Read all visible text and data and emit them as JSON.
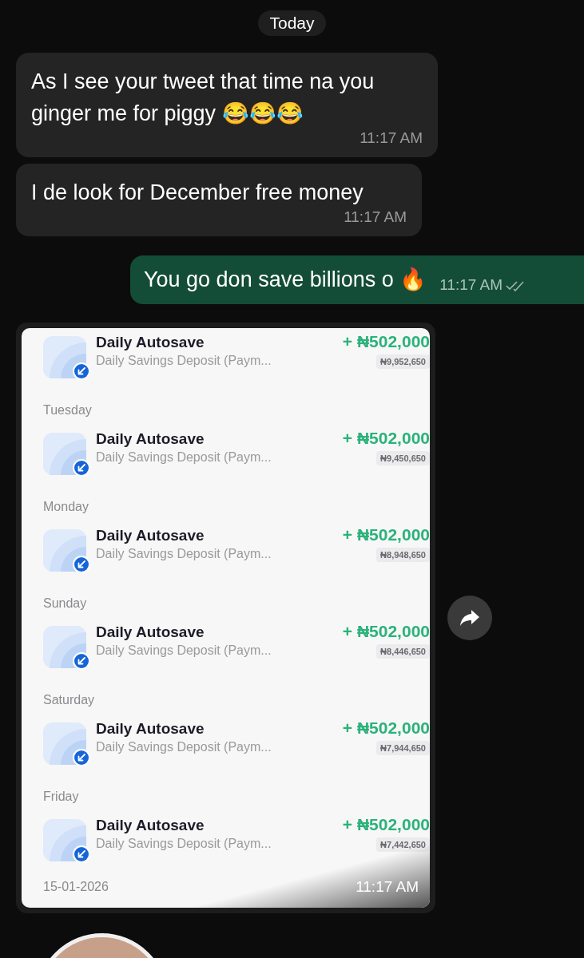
{
  "date_divider": "Today",
  "messages": [
    {
      "outgoing": false,
      "text": "As I see your tweet that time na you ginger me for piggy 😂😂😂",
      "time": "11:17 AM"
    },
    {
      "outgoing": false,
      "text": "I de look for December free money",
      "time": "11:17 AM"
    },
    {
      "outgoing": true,
      "text": "You go don save billions o 🔥",
      "time": "11:17 AM",
      "read": false
    }
  ],
  "image_message": {
    "transactions": [
      {
        "title": "Daily Autosave",
        "description": "Daily Savings Deposit (Paym...",
        "amount": "+ ₦502,000",
        "balance": "₦9,952,650"
      },
      {
        "day": "Tuesday",
        "title": "Daily Autosave",
        "description": "Daily Savings Deposit (Paym...",
        "amount": "+ ₦502,000",
        "balance": "₦9,450,650"
      },
      {
        "day": "Monday",
        "title": "Daily Autosave",
        "description": "Daily Savings Deposit (Paym...",
        "amount": "+ ₦502,000",
        "balance": "₦8,948,650"
      },
      {
        "day": "Sunday",
        "title": "Daily Autosave",
        "description": "Daily Savings Deposit (Paym...",
        "amount": "+ ₦502,000",
        "balance": "₦8,446,650"
      },
      {
        "day": "Saturday",
        "title": "Daily Autosave",
        "description": "Daily Savings Deposit (Paym...",
        "amount": "+ ₦502,000",
        "balance": "₦7,944,650"
      },
      {
        "day": "Friday",
        "title": "Daily Autosave",
        "description": "Daily Savings Deposit (Paym...",
        "amount": "+ ₦502,000",
        "balance": "₦7,442,650"
      }
    ],
    "date": "15-01-2026",
    "time": "11:17 AM"
  }
}
